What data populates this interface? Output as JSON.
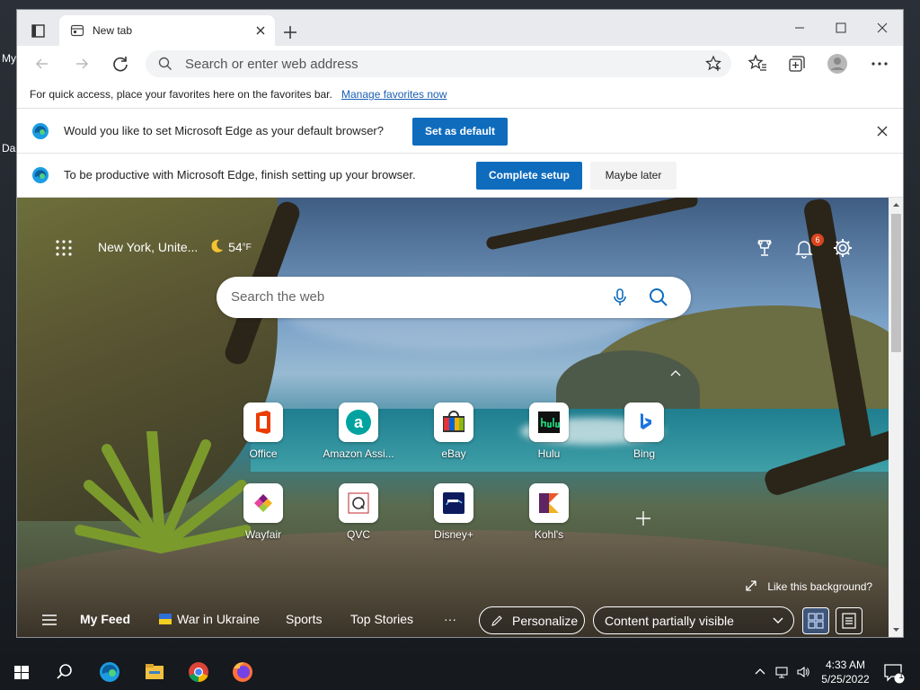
{
  "desktop": {
    "labels": [
      "My",
      "Da"
    ]
  },
  "browser": {
    "tab": {
      "title": "New tab"
    },
    "address_placeholder": "Search or enter web address",
    "favorites_bar": {
      "message": "For quick access, place your favorites here on the favorites bar.",
      "link": "Manage favorites now"
    },
    "infobar_default": {
      "message": "Would you like to set Microsoft Edge as your default browser?",
      "button": "Set as default"
    },
    "infobar_setup": {
      "message": "To be productive with Microsoft Edge, finish setting up your browser.",
      "primary": "Complete setup",
      "secondary": "Maybe later"
    }
  },
  "ntp": {
    "weather": {
      "location": "New York, Unite...",
      "temp": "54",
      "unit": "°F"
    },
    "notifications_count": "6",
    "search_placeholder": "Search the web",
    "quick_links": [
      {
        "label": "Office"
      },
      {
        "label": "Amazon Assi..."
      },
      {
        "label": "eBay"
      },
      {
        "label": "Hulu"
      },
      {
        "label": "Bing"
      },
      {
        "label": "Wayfair"
      },
      {
        "label": "QVC"
      },
      {
        "label": "Disney+"
      },
      {
        "label": "Kohl's"
      }
    ],
    "background_prompt": "Like this background?",
    "feed": {
      "my_feed": "My Feed",
      "war_in_ukraine": "War in Ukraine",
      "sports": "Sports",
      "top_stories": "Top Stories",
      "more": "···",
      "personalize": "Personalize",
      "content_visibility": "Content partially visible"
    }
  },
  "taskbar": {
    "time": "4:33 AM",
    "date": "5/25/2022",
    "notification_count": "1"
  },
  "colors": {
    "accent": "#0f6cbd",
    "badge": "#d9461f"
  }
}
